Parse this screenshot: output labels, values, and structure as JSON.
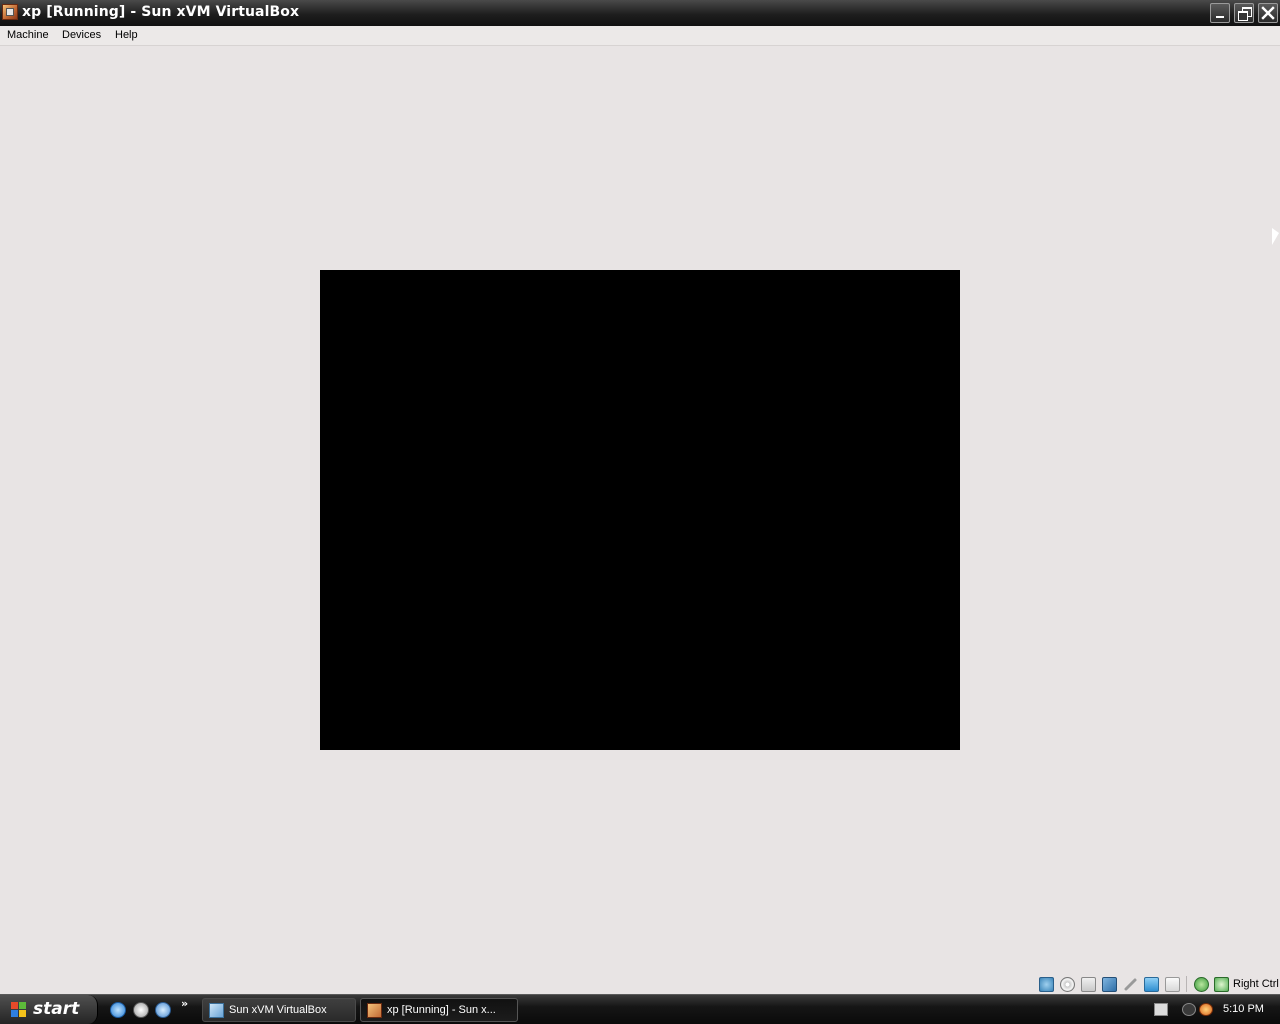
{
  "window": {
    "title": "xp [Running] - Sun xVM VirtualBox",
    "icon": "virtualbox-vm-icon"
  },
  "menu": {
    "items": [
      "Machine",
      "Devices",
      "Help"
    ]
  },
  "vm_screen": {
    "state": "black"
  },
  "status_bar": {
    "icons": [
      "hard-disk-icon",
      "cd-dvd-icon",
      "floppy-icon",
      "network-icon",
      "usb-icon",
      "shared-folders-icon",
      "vrdp-icon",
      "mouse-integration-icon",
      "host-key-capture-icon"
    ],
    "host_key_label": "Right Ctrl"
  },
  "taskbar": {
    "start_label": "start",
    "quick_launch": [
      "internet-explorer-icon",
      "media-player-icon",
      "browser-icon"
    ],
    "quick_launch_more": "»",
    "tasks": [
      {
        "label": "Sun xVM VirtualBox",
        "icon": "virtualbox-icon",
        "active": false
      },
      {
        "label": "xp [Running] - Sun x...",
        "icon": "vm-window-icon",
        "active": true
      }
    ],
    "tray_icons": [
      "keyboard-icon",
      "collapse-icon",
      "antivirus-icon"
    ],
    "clock": "5:10 PM"
  }
}
